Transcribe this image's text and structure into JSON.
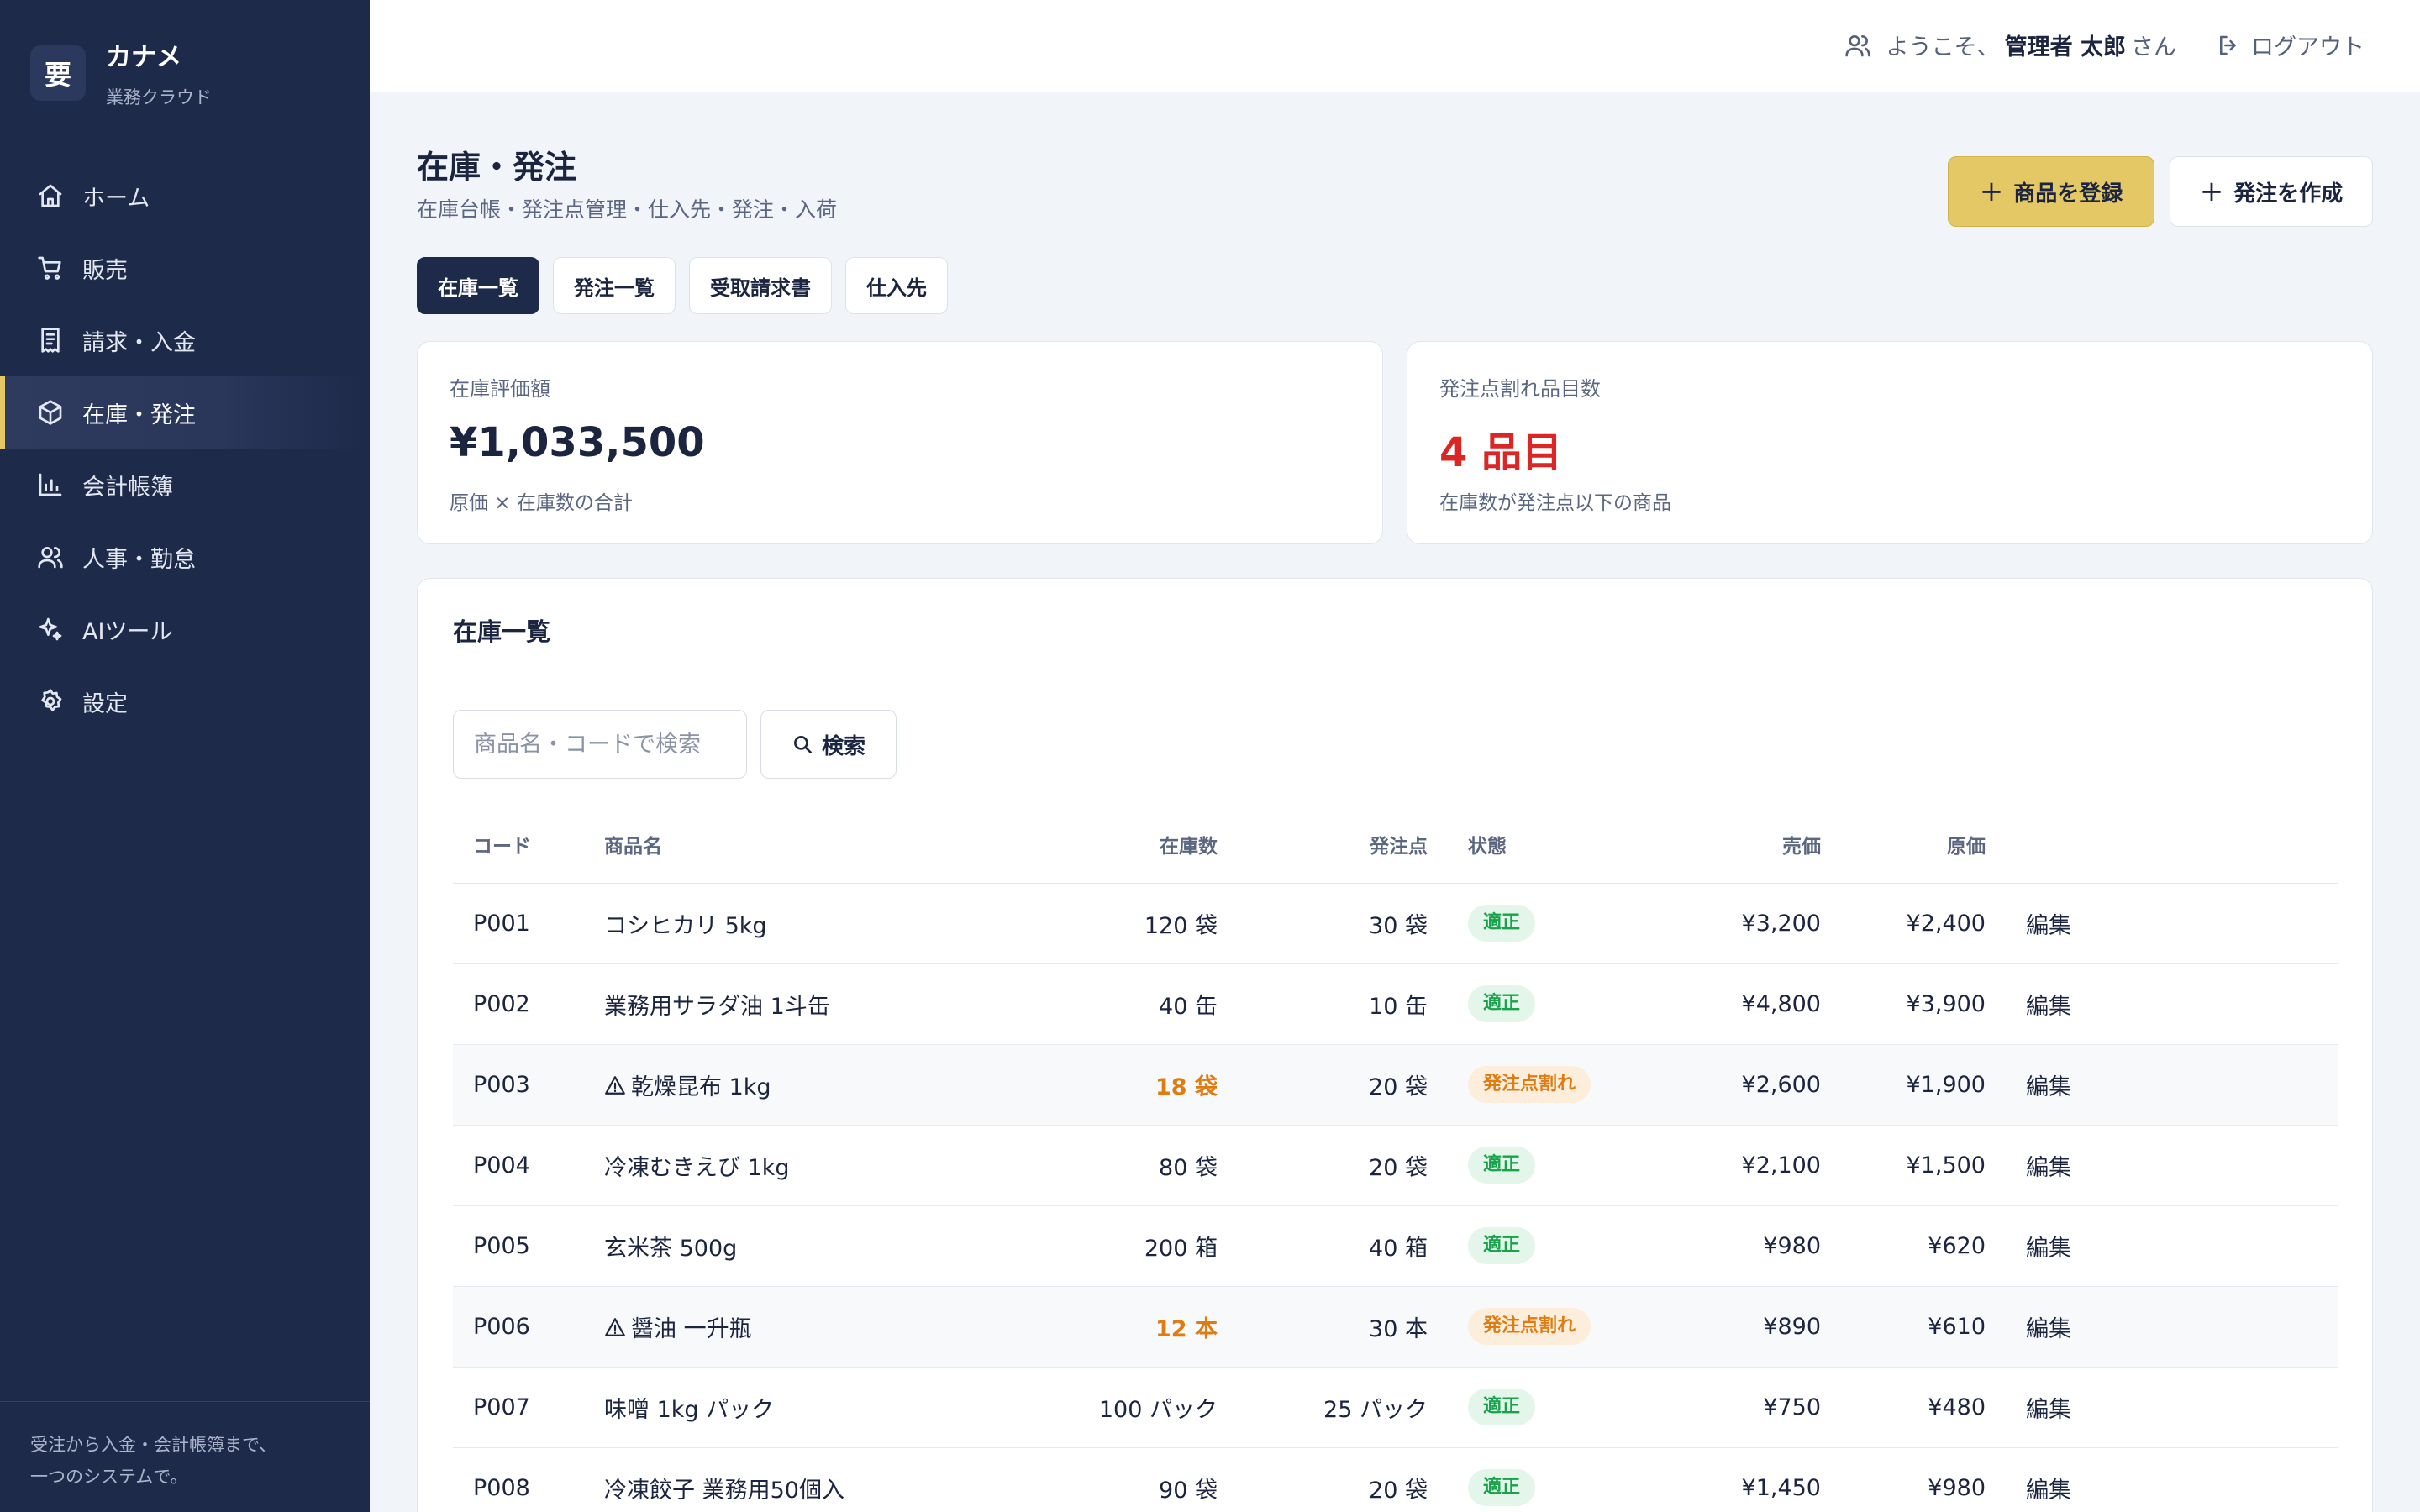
{
  "brand": {
    "logo": "要",
    "name": "カナメ",
    "subtitle": "業務クラウド"
  },
  "sidebar": {
    "items": [
      {
        "label": "ホーム",
        "icon": "home-icon"
      },
      {
        "label": "販売",
        "icon": "cart-icon"
      },
      {
        "label": "請求・入金",
        "icon": "receipt-icon"
      },
      {
        "label": "在庫・発注",
        "icon": "box-icon",
        "active": true
      },
      {
        "label": "会計帳簿",
        "icon": "bar-chart-icon"
      },
      {
        "label": "人事・勤怠",
        "icon": "users-icon"
      },
      {
        "label": "AIツール",
        "icon": "sparkles-icon"
      },
      {
        "label": "設定",
        "icon": "gear-icon"
      }
    ],
    "footer_line1": "受注から入金・会計帳簿まで、",
    "footer_line2": "一つのシステムで。"
  },
  "topbar": {
    "welcome_prefix": "ようこそ、",
    "user_name": "管理者 太郎",
    "welcome_suffix": "さん",
    "logout_label": "ログアウト"
  },
  "header": {
    "title": "在庫・発注",
    "subtitle": "在庫台帳・発注点管理・仕入先・発注・入荷",
    "register_button": "商品を登録",
    "create_order_button": "発注を作成"
  },
  "tabs": [
    {
      "label": "在庫一覧",
      "active": true
    },
    {
      "label": "発注一覧"
    },
    {
      "label": "受取請求書"
    },
    {
      "label": "仕入先"
    }
  ],
  "stats": {
    "valuation": {
      "label": "在庫評価額",
      "value": "¥1,033,500",
      "note": "原価 × 在庫数の合計"
    },
    "below_reorder": {
      "label": "発注点割れ品目数",
      "value": "4 品目",
      "note": "在庫数が発注点以下の商品"
    }
  },
  "inventory": {
    "title": "在庫一覧",
    "search_placeholder": "商品名・コードで検索",
    "search_button": "検索",
    "columns": {
      "code": "コード",
      "name": "商品名",
      "stock": "在庫数",
      "reorder_point": "発注点",
      "status": "状態",
      "price": "売価",
      "cost": "原価"
    },
    "rows": [
      {
        "code": "P001",
        "name": "コシヒカリ 5kg",
        "stock": "120 袋",
        "reorder_point": "30 袋",
        "status": "適正",
        "price": "¥3,200",
        "cost": "¥2,400",
        "edit": "編集",
        "warn": false
      },
      {
        "code": "P002",
        "name": "業務用サラダ油 1斗缶",
        "stock": "40 缶",
        "reorder_point": "10 缶",
        "status": "適正",
        "price": "¥4,800",
        "cost": "¥3,900",
        "edit": "編集",
        "warn": false
      },
      {
        "code": "P003",
        "name": "乾燥昆布 1kg",
        "stock": "18 袋",
        "reorder_point": "20 袋",
        "status": "発注点割れ",
        "price": "¥2,600",
        "cost": "¥1,900",
        "edit": "編集",
        "warn": true
      },
      {
        "code": "P004",
        "name": "冷凍むきえび 1kg",
        "stock": "80 袋",
        "reorder_point": "20 袋",
        "status": "適正",
        "price": "¥2,100",
        "cost": "¥1,500",
        "edit": "編集",
        "warn": false
      },
      {
        "code": "P005",
        "name": "玄米茶 500g",
        "stock": "200 箱",
        "reorder_point": "40 箱",
        "status": "適正",
        "price": "¥980",
        "cost": "¥620",
        "edit": "編集",
        "warn": false
      },
      {
        "code": "P006",
        "name": "醤油 一升瓶",
        "stock": "12 本",
        "reorder_point": "30 本",
        "status": "発注点割れ",
        "price": "¥890",
        "cost": "¥610",
        "edit": "編集",
        "warn": true
      },
      {
        "code": "P007",
        "name": "味噌 1kg パック",
        "stock": "100 パック",
        "reorder_point": "25 パック",
        "status": "適正",
        "price": "¥750",
        "cost": "¥480",
        "edit": "編集",
        "warn": false
      },
      {
        "code": "P008",
        "name": "冷凍餃子 業務用50個入",
        "stock": "90 袋",
        "reorder_point": "20 袋",
        "status": "適正",
        "price": "¥1,450",
        "cost": "¥980",
        "edit": "編集",
        "warn": false
      }
    ]
  },
  "colors": {
    "sidebar_bg": "#1e2a4a",
    "accent": "#e5c866",
    "danger": "#dc2626",
    "warning": "#e07b12",
    "success": "#16a34a"
  }
}
